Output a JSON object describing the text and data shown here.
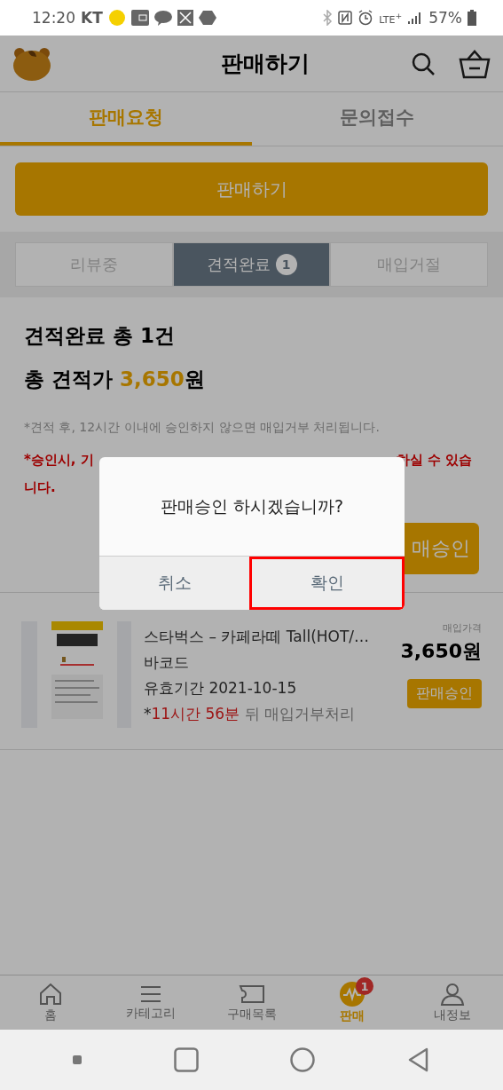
{
  "status_bar": {
    "time": "12:20",
    "carrier": "KT",
    "network": "LTE",
    "network_plus": "+",
    "battery": "57%"
  },
  "header": {
    "title": "판매하기"
  },
  "tabs": [
    {
      "label": "판매요청",
      "selected": true
    },
    {
      "label": "문의접수",
      "selected": false
    }
  ],
  "sell_button": "판매하기",
  "segments": [
    {
      "label": "리뷰중",
      "selected": false
    },
    {
      "label": "견적완료",
      "selected": true,
      "badge": "1"
    },
    {
      "label": "매입거절",
      "selected": false
    }
  ],
  "summary": {
    "title": "견적완료 총 1건",
    "total_label": "총 견적가",
    "total_value": "3,650",
    "total_unit": "원",
    "notice": "*견적 후, 12시간 이내에 승인하지 않으면 매입거부 처리됩니다.",
    "warning_start": "*승인시, 기",
    "warning_end": "하실 수 있습",
    "warning_line2": "니다.",
    "approve_button": "매승인"
  },
  "product": {
    "kind": "picture",
    "title": "스타벅스 – 카페라떼 Tall(HOT/…",
    "type": "바코드",
    "expiry": "유효기간 2021-10-15",
    "countdown_prefix": "*",
    "countdown_time": "11시간 56분",
    "countdown_suffix": " 뒤 매입거부처리",
    "price_label": "매입가격",
    "price": "3,650원",
    "approve_button": "판매승인"
  },
  "dialog": {
    "message": "판매승인 하시겠습니까?",
    "buttons": [
      {
        "label": "취소",
        "highlighted": false
      },
      {
        "label": "확인",
        "highlighted": true
      }
    ]
  },
  "bottom_nav": [
    {
      "kind": "home",
      "label": "홈",
      "selected": false
    },
    {
      "kind": "menu",
      "label": "카테고리",
      "selected": false
    },
    {
      "kind": "ticket",
      "label": "구매목록",
      "selected": false
    },
    {
      "kind": "sell",
      "label": "판매",
      "selected": true,
      "badge": "1"
    },
    {
      "kind": "person",
      "label": "내정보",
      "selected": false
    }
  ]
}
